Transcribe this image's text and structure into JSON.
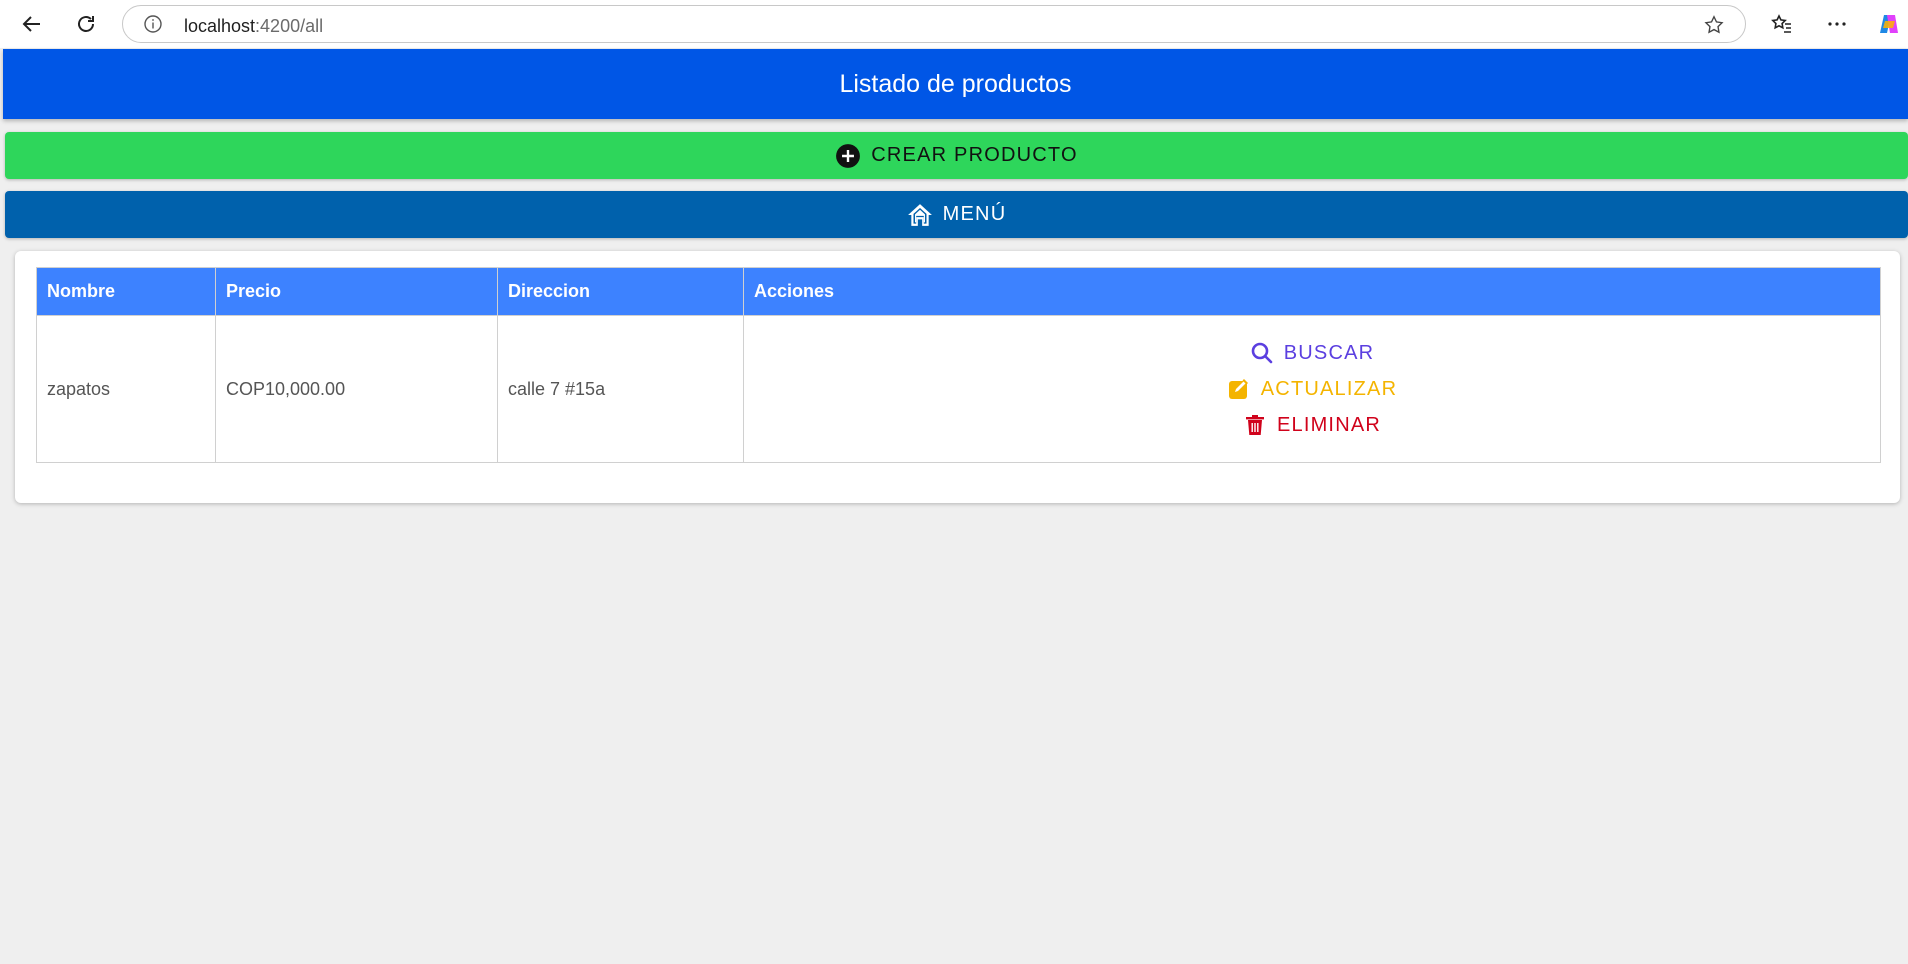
{
  "browser": {
    "url_host": "localhost",
    "url_path": ":4200/all",
    "icons": {
      "back": "back-arrow-icon",
      "reload": "reload-icon",
      "info": "info-icon",
      "favorite": "star-icon",
      "favorites_list": "favorites-icon",
      "more": "more-icon",
      "copilot": "copilot-icon"
    }
  },
  "header": {
    "title": "Listado de productos",
    "color": "#0056e6"
  },
  "buttons": {
    "crear": {
      "label": "CREAR PRODUCTO",
      "icon": "plus-circle-icon",
      "color": "#2ed65b"
    },
    "menu": {
      "label": "MENÚ",
      "icon": "home-icon",
      "color": "#0061ac"
    }
  },
  "table": {
    "headers": [
      "Nombre",
      "Precio",
      "Direccion",
      "Acciones"
    ],
    "rows": [
      {
        "nombre": "zapatos",
        "precio": "COP10,000.00",
        "direccion": "calle 7 #15a",
        "acciones": [
          {
            "label": "BUSCAR",
            "icon": "search-icon",
            "color": "#5b3fe0"
          },
          {
            "label": "ACTUALIZAR",
            "icon": "edit-icon",
            "color": "#f4b400"
          },
          {
            "label": "ELIMINAR",
            "icon": "trash-icon",
            "color": "#d0021b"
          }
        ]
      }
    ]
  }
}
